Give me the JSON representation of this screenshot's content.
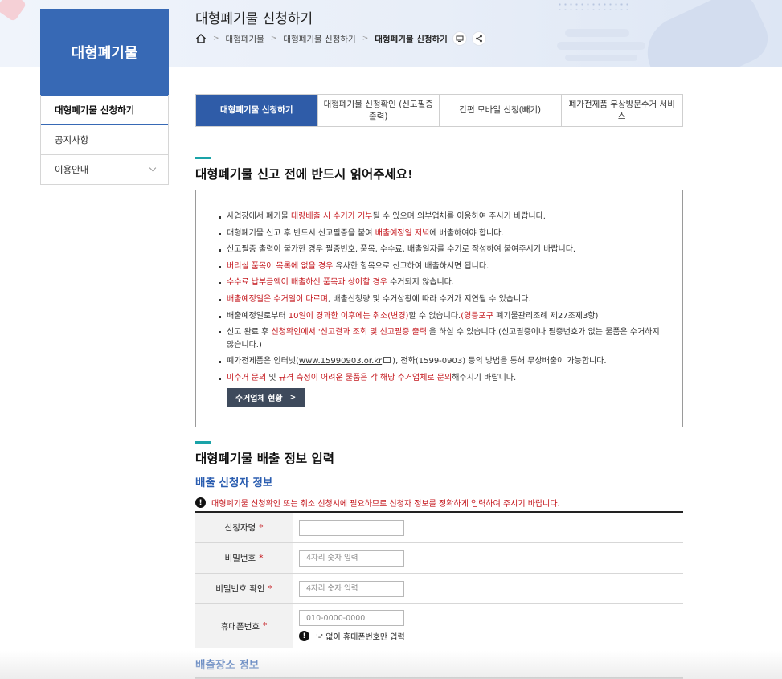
{
  "sidebar": {
    "title": "대형폐기물",
    "items": [
      {
        "label": "대형폐기물 신청하기",
        "active": true
      },
      {
        "label": "공지사항"
      },
      {
        "label": "이용안내",
        "has_submenu": true
      }
    ]
  },
  "header": {
    "title": "대형폐기물 신청하기",
    "breadcrumb": [
      "대형폐기물",
      "대형폐기물 신청하기",
      "대형폐기물 신청하기"
    ]
  },
  "tabs": [
    {
      "label": "대형폐기물 신청하기",
      "active": true
    },
    {
      "label": "대형폐기물 신청확인 (신고필증 출력)"
    },
    {
      "label": "간편 모바일 신청(빼기)"
    },
    {
      "label": "폐가전제품 무상방문수거 서비스"
    }
  ],
  "notice": {
    "title": "대형폐기물 신고 전에 반드시 읽어주세요!",
    "items": [
      {
        "parts": [
          {
            "t": "사업장에서 폐기물 "
          },
          {
            "t": "대량배출 시 수거가 거부",
            "red": true
          },
          {
            "t": "될 수 있으며 외부업체를 이용하여 주시기 바랍니다."
          }
        ]
      },
      {
        "parts": [
          {
            "t": "대형폐기물 신고 후 반드시 신고필증을 붙여 "
          },
          {
            "t": "배출예정일 저녁",
            "red": true
          },
          {
            "t": "에 배출하여야 합니다."
          }
        ]
      },
      {
        "parts": [
          {
            "t": "신고필증 출력이 불가한 경우 필증번호, 품목, 수수료, 배출일자를 수기로 작성하여 붙여주시기 바랍니다."
          }
        ]
      },
      {
        "parts": [
          {
            "t": "버리실 품목이 목록에 없을 경우",
            "red": true
          },
          {
            "t": " 유사한 항목으로 신고하여 배출하시면 됩니다."
          }
        ]
      },
      {
        "parts": [
          {
            "t": "수수료 납부금액이 배출하신 품목과 상이할 경우",
            "red": true
          },
          {
            "t": " 수거되지 않습니다."
          }
        ]
      },
      {
        "parts": [
          {
            "t": "배출예정일은 수거일이 다르며",
            "red": true
          },
          {
            "t": ", 배출신청량 및 수거상황에 따라 수거가 지연될 수 있습니다."
          }
        ]
      },
      {
        "parts": [
          {
            "t": "배출예정일로부터 "
          },
          {
            "t": "10일이 경과한 이후에는 취소(변경)",
            "red": true
          },
          {
            "t": "할 수 없습니다."
          },
          {
            "t": "(영등포구",
            "red": true
          },
          {
            "t": " 폐기물관리조례 제27조제3항)"
          }
        ]
      },
      {
        "two": true,
        "parts": [
          {
            "t": "신고 완료 후 "
          },
          {
            "t": "신청확인에서 '신고결과 조회 및 신고필증 출력'",
            "red": true
          },
          {
            "t": "을 하실 수 있습니다.(신고필증이나 필증번호가 없는 물품은 수거하지 않습니다.)"
          }
        ]
      },
      {
        "parts": [
          {
            "t": "폐가전제품은 인터넷("
          },
          {
            "t": "www.15990903.or.kr",
            "link": true
          },
          {
            "t": "",
            "ext": true
          },
          {
            "t": "), 전화(1599-0903) 등의 방법을 통해 무상배출이 가능합니다."
          }
        ]
      },
      {
        "parts": [
          {
            "t": "미수거 문의",
            "red": true
          },
          {
            "t": " 및 "
          },
          {
            "t": "규격 측정이 어려운 물품은 각 해당 수거업체로 문의",
            "red": true
          },
          {
            "t": "해주시기 바랍니다."
          }
        ]
      }
    ],
    "button_label": "수거업체 현황"
  },
  "form_section": {
    "title": "대형폐기물 배출 정보 입력",
    "applicant_title": "배출 신청자 정보",
    "alert": "대형폐기물 신청확인 또는 취소 신청시에 필요하므로 신청자 정보를 정확하게 입력하여 주시기 바랍니다.",
    "fields": [
      {
        "label": "신청자명",
        "placeholder": "",
        "value": ""
      },
      {
        "label": "비밀번호",
        "placeholder": "4자리 숫자 입력",
        "value": ""
      },
      {
        "label": "비밀번호 확인",
        "placeholder": "4자리 숫자 입력",
        "value": ""
      },
      {
        "label": "휴대폰번호",
        "placeholder": "010-0000-0000",
        "value": "",
        "hint": "'-' 없이 휴대폰번호만 입력"
      }
    ],
    "required_mark": "*",
    "location_title": "배출장소 정보"
  },
  "colors": {
    "primary": "#3769b5",
    "tab_active": "#2f5ca8",
    "accent_bar": "#1aa3a8",
    "warning_red": "#c4161c",
    "button_dark": "#3e4a5c"
  }
}
